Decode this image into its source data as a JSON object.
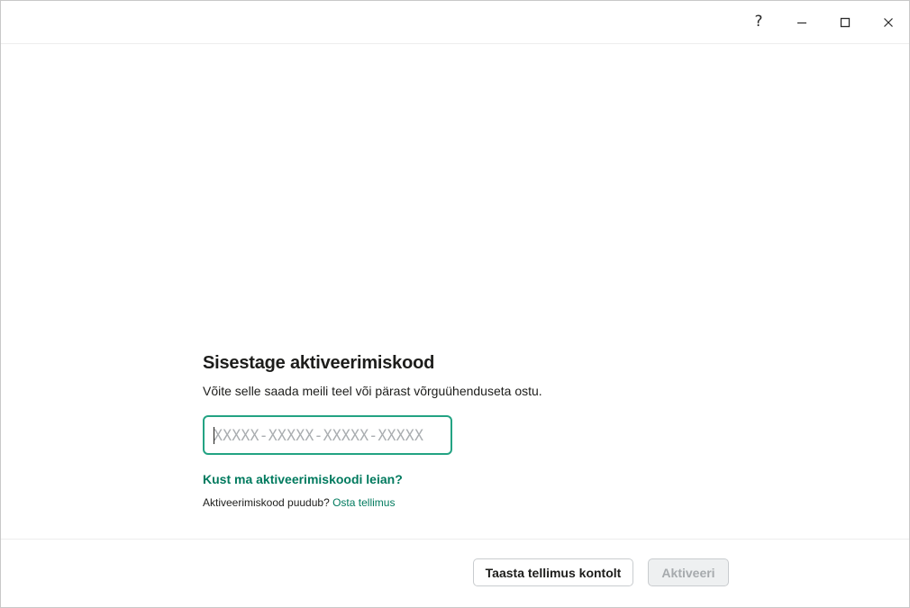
{
  "titlebar": {
    "help_glyph": "?",
    "icons": [
      "help-icon",
      "minimize-icon",
      "maximize-icon",
      "close-icon"
    ]
  },
  "main": {
    "heading": "Sisestage aktiveerimiskood",
    "subtitle": "Võite selle saada meili teel või pärast võrguühenduseta ostu.",
    "code_input": {
      "value": "",
      "placeholder": "XXXXX-XXXXX-XXXXX-XXXXX"
    },
    "help_link": "Kust ma aktiveerimiskoodi leian?",
    "no_code_text": "Aktiveerimiskood puudub?",
    "buy_link": "Osta tellimus"
  },
  "footer": {
    "restore_label": "Taasta tellimus kontolt",
    "activate_label": "Aktiveeri"
  },
  "colors": {
    "accent": "#23a383",
    "link": "#007a5e",
    "disabled_text": "#a6aaad",
    "disabled_bg": "#eef0f1"
  }
}
